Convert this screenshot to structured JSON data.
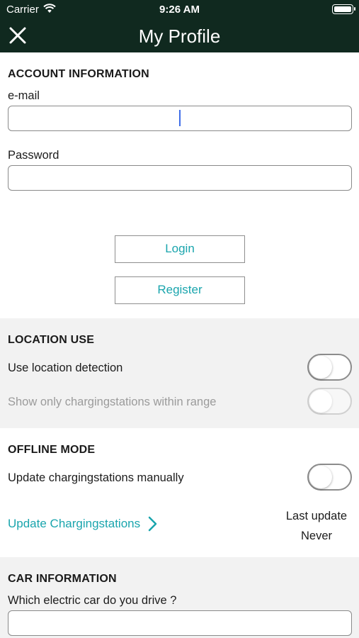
{
  "status_bar": {
    "carrier": "Carrier",
    "time": "9:26 AM"
  },
  "nav": {
    "title": "My Profile",
    "close_icon": "close-icon"
  },
  "account": {
    "heading": "ACCOUNT INFORMATION",
    "email_label": "e-mail",
    "email_value": "",
    "password_label": "Password",
    "password_value": "",
    "login_label": "Login",
    "register_label": "Register"
  },
  "location": {
    "heading": "LOCATION USE",
    "detection_label": "Use location detection",
    "detection_on": false,
    "range_label": "Show only chargingstations within range",
    "range_on": false,
    "range_enabled": false
  },
  "offline": {
    "heading": "OFFLINE MODE",
    "manual_label": "Update chargingstations manually",
    "manual_on": false,
    "update_link": "Update Chargingstations",
    "last_update_label": "Last update",
    "last_update_value": "Never"
  },
  "car": {
    "heading": "CAR INFORMATION",
    "question": "Which electric car do you drive ?",
    "value": ""
  },
  "colors": {
    "nav_bg": "#10291f",
    "accent": "#1aa5ad",
    "section_alt_bg": "#f2f2f2"
  }
}
